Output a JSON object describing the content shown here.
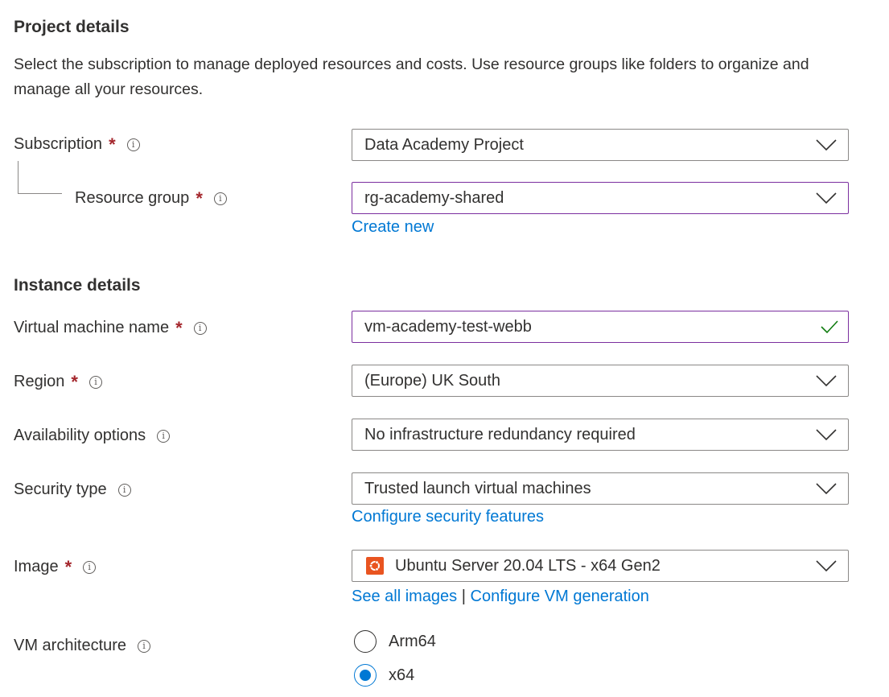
{
  "project": {
    "title": "Project details",
    "description": "Select the subscription to manage deployed resources and costs. Use resource groups like folders to organize and manage all your resources.",
    "subscription": {
      "label": "Subscription",
      "required": "*",
      "value": "Data Academy Project"
    },
    "resource_group": {
      "label": "Resource group",
      "required": "*",
      "value": "rg-academy-shared",
      "create_new": "Create new"
    }
  },
  "instance": {
    "title": "Instance details",
    "vm_name": {
      "label": "Virtual machine name",
      "required": "*",
      "value": "vm-academy-test-webb"
    },
    "region": {
      "label": "Region",
      "required": "*",
      "value": "(Europe) UK South"
    },
    "availability": {
      "label": "Availability options",
      "value": "No infrastructure redundancy required"
    },
    "security": {
      "label": "Security type",
      "value": "Trusted launch virtual machines",
      "link": "Configure security features"
    },
    "image": {
      "label": "Image",
      "required": "*",
      "value": "Ubuntu Server 20.04 LTS - x64 Gen2",
      "link_all": "See all images",
      "separator": "|",
      "link_gen": "Configure VM generation"
    },
    "architecture": {
      "label": "VM architecture",
      "options": [
        "Arm64",
        "x64"
      ],
      "selected": "x64"
    }
  },
  "info_glyph": "i",
  "colors": {
    "accent": "#0078d4",
    "required": "#a4262c",
    "focus_border": "#7b2f9f",
    "valid": "#107c10",
    "ubuntu": "#e95420"
  }
}
